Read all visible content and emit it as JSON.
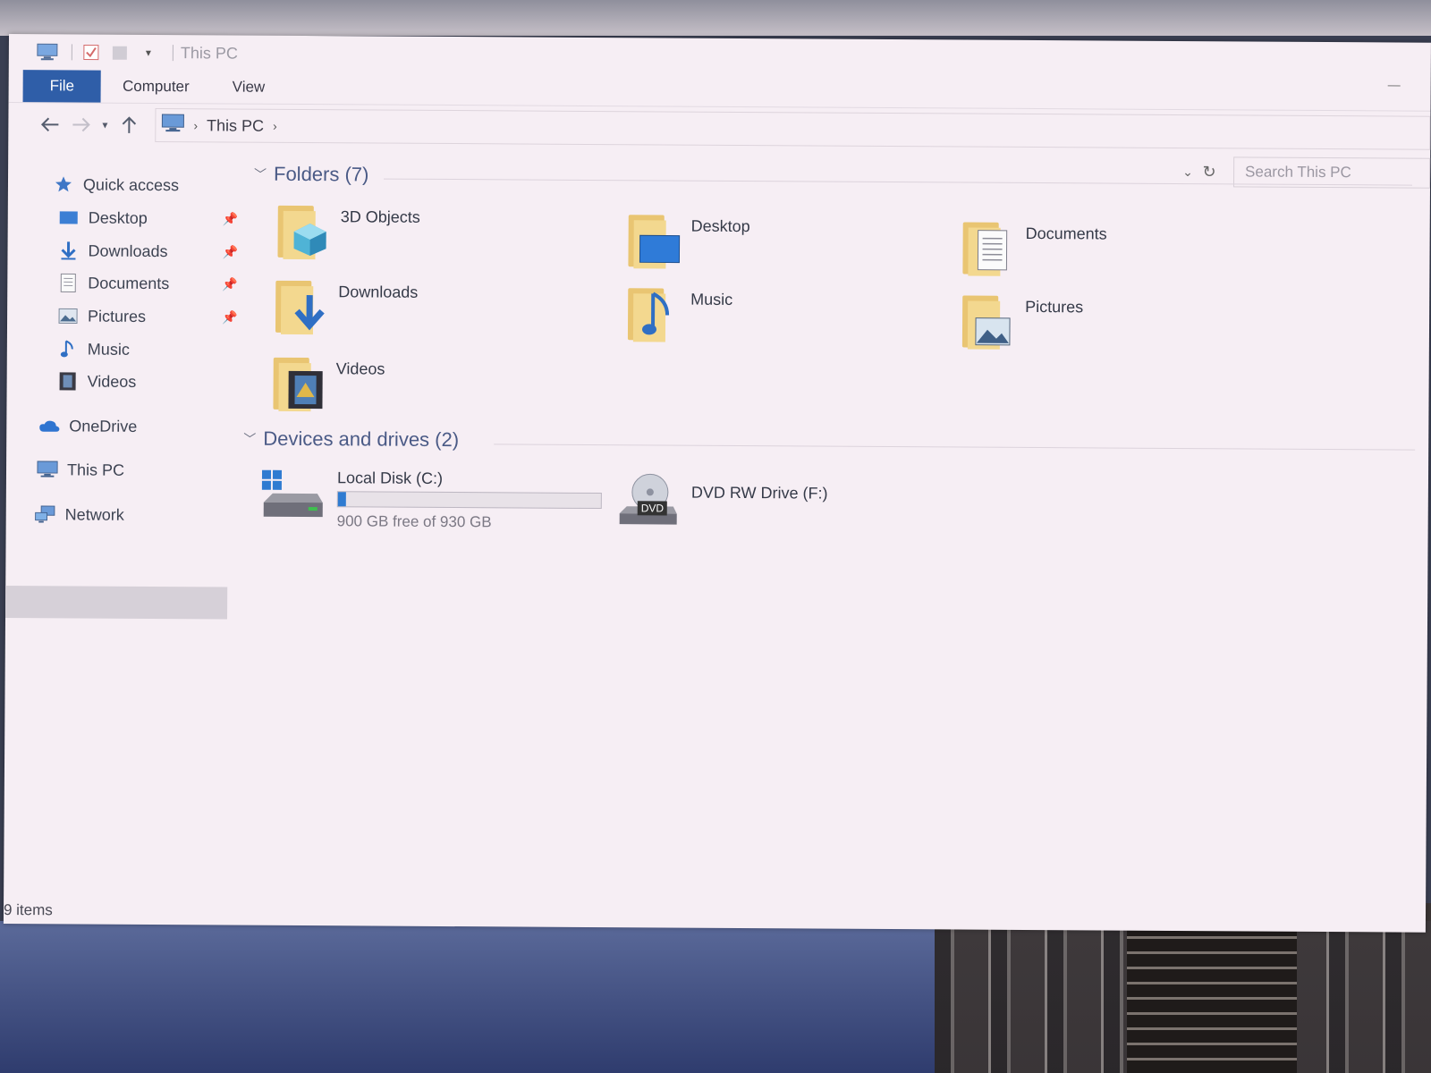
{
  "window": {
    "title": "This PC",
    "tabs": [
      "File",
      "Computer",
      "View"
    ]
  },
  "navigation": {
    "back_icon": "arrow-left-icon",
    "forward_icon": "arrow-right-icon",
    "up_icon": "arrow-up-icon",
    "breadcrumb": [
      "This PC"
    ],
    "search_placeholder": "Search This PC"
  },
  "sidebar": {
    "quick_access": "Quick access",
    "pinned": [
      {
        "label": "Desktop",
        "icon": "desktop-icon"
      },
      {
        "label": "Downloads",
        "icon": "download-icon"
      },
      {
        "label": "Documents",
        "icon": "document-icon"
      },
      {
        "label": "Pictures",
        "icon": "picture-icon"
      }
    ],
    "others": [
      {
        "label": "Music",
        "icon": "music-icon"
      },
      {
        "label": "Videos",
        "icon": "video-icon"
      }
    ],
    "onedrive": "OneDrive",
    "this_pc": "This PC",
    "network": "Network"
  },
  "content": {
    "folders_header": "Folders (7)",
    "folders": [
      {
        "label": "3D Objects",
        "icon": "3d-cube-icon"
      },
      {
        "label": "Desktop",
        "icon": "desktop-icon"
      },
      {
        "label": "Documents",
        "icon": "document-icon"
      },
      {
        "label": "Downloads",
        "icon": "download-icon"
      },
      {
        "label": "Music",
        "icon": "music-icon"
      },
      {
        "label": "Pictures",
        "icon": "picture-icon"
      },
      {
        "label": "Videos",
        "icon": "video-icon"
      }
    ],
    "drives_header": "Devices and drives (2)",
    "drives": [
      {
        "label": "Local Disk (C:)",
        "free_text": "900 GB free of 930 GB",
        "used_fraction": 0.032,
        "icon": "hard-disk-icon"
      },
      {
        "label": "DVD RW Drive (F:)",
        "icon": "dvd-drive-icon",
        "badge": "DVD"
      }
    ]
  },
  "status": {
    "items": "9 items"
  },
  "colors": {
    "accent": "#2f5ea8",
    "folder": "#f3d88f",
    "header_text": "#4a5a86",
    "drive_fill": "#2f7bd1"
  }
}
